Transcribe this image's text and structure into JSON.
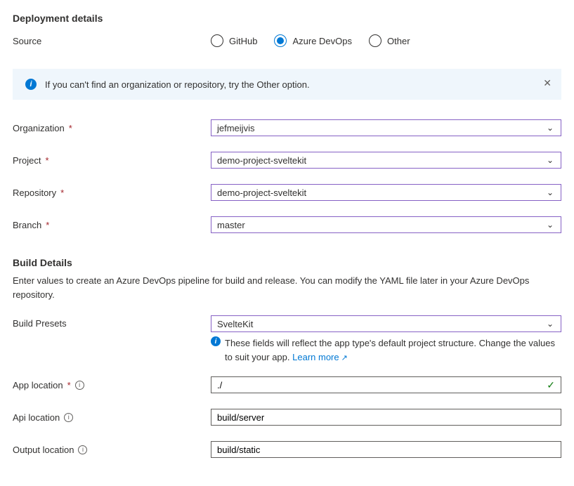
{
  "headings": {
    "deployment": "Deployment details",
    "build": "Build Details"
  },
  "source": {
    "label": "Source",
    "options": {
      "github": "GitHub",
      "devops": "Azure DevOps",
      "other": "Other"
    },
    "selected": "devops"
  },
  "banner": {
    "text": "If you can't find an organization or repository, try the Other option."
  },
  "fields": {
    "organization": {
      "label": "Organization",
      "value": "jefmeijvis"
    },
    "project": {
      "label": "Project",
      "value": "demo-project-sveltekit"
    },
    "repository": {
      "label": "Repository",
      "value": "demo-project-sveltekit"
    },
    "branch": {
      "label": "Branch",
      "value": "master"
    }
  },
  "build": {
    "description": "Enter values to create an Azure DevOps pipeline for build and release. You can modify the YAML file later in your Azure DevOps repository.",
    "presets": {
      "label": "Build Presets",
      "value": "SvelteKit"
    },
    "hint": "These fields will reflect the app type's default project structure. Change the values to suit your app.",
    "learn_more": "Learn more",
    "app_location": {
      "label": "App location",
      "value": "./"
    },
    "api_location": {
      "label": "Api location",
      "value": "build/server"
    },
    "output_location": {
      "label": "Output location",
      "value": "build/static"
    }
  }
}
